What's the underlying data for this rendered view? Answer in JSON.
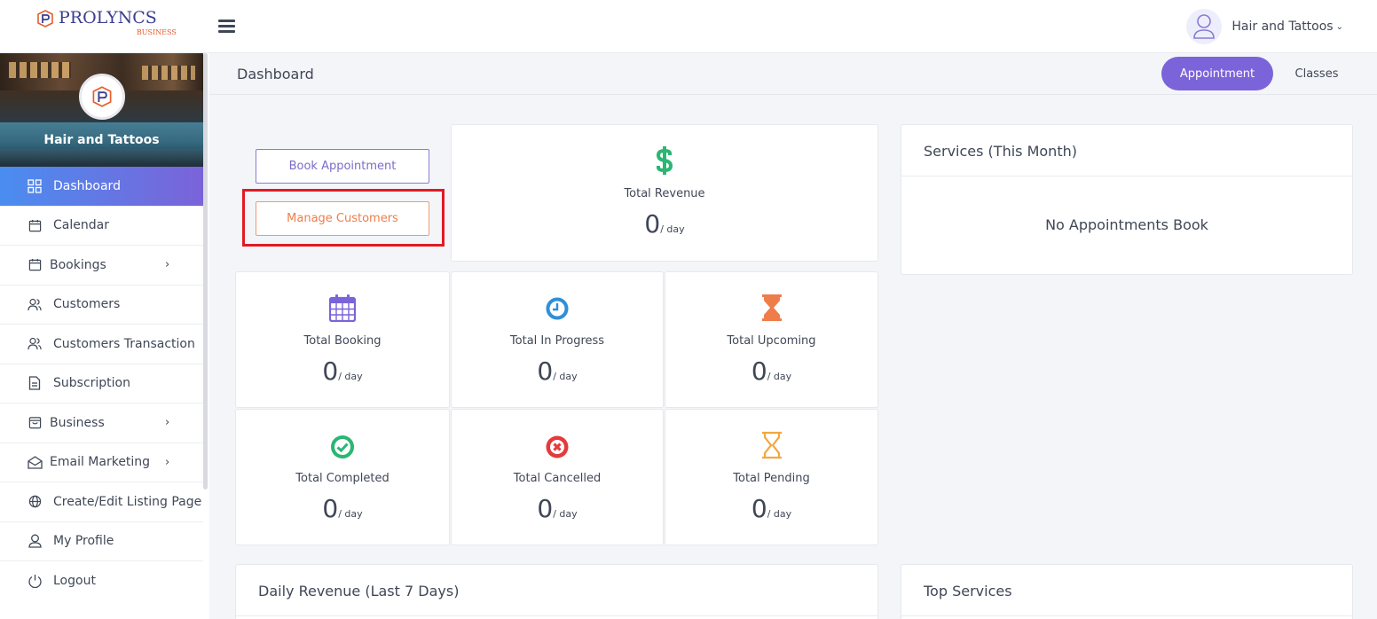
{
  "brand": {
    "name": "PROLYNCS",
    "sub": "BUSINESS",
    "accent": "#3b3f8f",
    "sub_color": "#e85d2a"
  },
  "topbar": {
    "user_name": "Hair and Tattoos",
    "caret": "⌄"
  },
  "sidebar": {
    "business_name": "Hair and Tattoos",
    "items": [
      {
        "label": "Dashboard",
        "icon": "dashboard-grid-icon",
        "active": true
      },
      {
        "label": "Calendar",
        "icon": "calendar-icon"
      },
      {
        "label": "Bookings",
        "icon": "calendar-icon",
        "arrow": "›"
      },
      {
        "label": "Customers",
        "icon": "users-icon"
      },
      {
        "label": "Customers Transaction",
        "icon": "users-icon"
      },
      {
        "label": "Subscription",
        "icon": "document-icon"
      },
      {
        "label": "Business",
        "icon": "shopping-bag-icon",
        "arrow": "›"
      },
      {
        "label": "Email Marketing",
        "icon": "envelope-icon",
        "arrow": "›"
      },
      {
        "label": "Create/Edit Listing Page",
        "icon": "globe-icon"
      },
      {
        "label": "My Profile",
        "icon": "user-icon"
      },
      {
        "label": "Logout",
        "icon": "power-icon"
      }
    ]
  },
  "header": {
    "title": "Dashboard",
    "tabs": [
      "Appointment",
      "Classes"
    ],
    "active_tab": "Appointment"
  },
  "actions": {
    "book": "Book Appointment",
    "manage": "Manage Customers"
  },
  "revenue": {
    "label": "Total Revenue",
    "value": "0",
    "unit": "/ day",
    "icon": "dollar-icon",
    "color": "#2bb673"
  },
  "stats": [
    {
      "label": "Total Booking",
      "value": "0",
      "unit": "/ day",
      "icon": "calendar-grid-icon",
      "color": "#7b63d9"
    },
    {
      "label": "Total In Progress",
      "value": "0",
      "unit": "/ day",
      "icon": "clock-icon",
      "color": "#2f8fd8"
    },
    {
      "label": "Total Upcoming",
      "value": "0",
      "unit": "/ day",
      "icon": "hourglass-filled-icon",
      "color": "#ef7d4a"
    },
    {
      "label": "Total Completed",
      "value": "0",
      "unit": "/ day",
      "icon": "check-circle-icon",
      "color": "#2bb673"
    },
    {
      "label": "Total Cancelled",
      "value": "0",
      "unit": "/ day",
      "icon": "x-circle-icon",
      "color": "#e33b3b"
    },
    {
      "label": "Total Pending",
      "value": "0",
      "unit": "/ day",
      "icon": "hourglass-outline-icon",
      "color": "#f4a640"
    }
  ],
  "services": {
    "title": "Services (This Month)",
    "empty": "No Appointments Book"
  },
  "daily_revenue": {
    "title": "Daily Revenue (Last 7 Days)"
  },
  "top_services": {
    "title": "Top Services"
  },
  "colors": {
    "primary": "#7b63d9",
    "active_gradient_start": "#4a8df0",
    "highlight": "#e01b24"
  }
}
